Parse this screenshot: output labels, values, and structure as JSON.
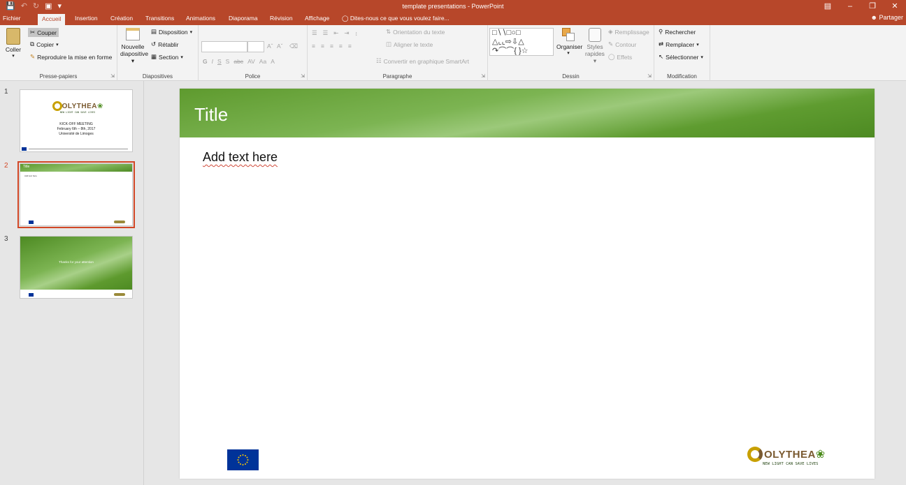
{
  "window": {
    "title": "template presentations - PowerPoint",
    "share_label": "Partager"
  },
  "tabs": [
    {
      "label": "Fichier"
    },
    {
      "label": "Accueil"
    },
    {
      "label": "Insertion"
    },
    {
      "label": "Création"
    },
    {
      "label": "Transitions"
    },
    {
      "label": "Animations"
    },
    {
      "label": "Diaporama"
    },
    {
      "label": "Révision"
    },
    {
      "label": "Affichage"
    }
  ],
  "tell_me": "Dites-nous ce que vous voulez faire...",
  "ribbon": {
    "clipboard": {
      "paste": "Coller",
      "cut": "Couper",
      "copy": "Copier",
      "format_painter": "Reproduire la mise en forme",
      "group_label": "Presse-papiers"
    },
    "slides": {
      "new_slide_1": "Nouvelle",
      "new_slide_2": "diapositive",
      "layout": "Disposition",
      "reset": "Rétablir",
      "section": "Section",
      "group_label": "Diapositives"
    },
    "font": {
      "group_label": "Police",
      "buttons": [
        "G",
        "I",
        "S",
        "S",
        "abc",
        "AV",
        "Aa",
        "A"
      ]
    },
    "paragraph": {
      "text_direction": "Orientation du texte",
      "align_text": "Aligner le texte",
      "smartart": "Convertir en graphique SmartArt",
      "group_label": "Paragraphe"
    },
    "drawing": {
      "arrange": "Organiser",
      "quick_styles_1": "Styles",
      "quick_styles_2": "rapides",
      "fill": "Remplissage",
      "outline": "Contour",
      "effects": "Effets",
      "group_label": "Dessin"
    },
    "editing": {
      "find": "Rechercher",
      "replace": "Remplacer",
      "select": "Sélectionner",
      "group_label": "Modification"
    }
  },
  "thumbnails": [
    {
      "number": "1",
      "line1": "KICK-OFF MEETING",
      "line2": "February 6th – 8th, 2017",
      "line3": "Université de Limoges",
      "logo_text": "OLYTHEA",
      "tagline": "NEW LIGHT CAN SAVE LIVES"
    },
    {
      "number": "2",
      "title": "Title",
      "body": "Add text here"
    },
    {
      "number": "3",
      "text": "Thanks for your attention"
    }
  ],
  "slide": {
    "title": "Title",
    "body": "Add text here",
    "logo_text": "OLYTHEA",
    "tagline": "NEW LIGHT CAN SAVE LIVES"
  },
  "colors": {
    "accent": "#b7472a",
    "selection": "#d24726",
    "header_green": "#5e9a2e",
    "eu_blue": "#003399"
  }
}
